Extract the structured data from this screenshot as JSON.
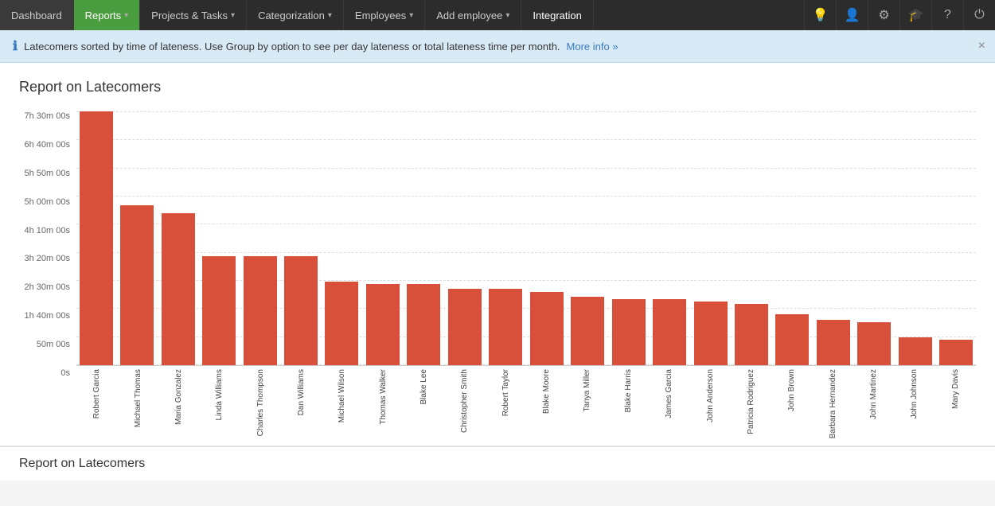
{
  "navbar": {
    "dashboard_label": "Dashboard",
    "reports_label": "Reports",
    "projects_label": "Projects & Tasks",
    "categorization_label": "Categorization",
    "employees_label": "Employees",
    "add_employee_label": "Add employee",
    "integration_label": "Integration"
  },
  "banner": {
    "text": "Latecomers sorted by time of lateness. Use Group by option to see per day lateness or total lateness time per month.",
    "link_text": "More info »"
  },
  "chart": {
    "title": "Report on Latecomers",
    "bottom_title": "Report on Latecomers",
    "y_labels": [
      "7h 30m 00s",
      "6h 40m 00s",
      "5h 50m 00s",
      "5h 00m 00s",
      "4h 10m 00s",
      "3h 20m 00s",
      "2h 30m 00s",
      "1h 40m 00s",
      "50m 00s",
      "0s"
    ],
    "bars": [
      {
        "name": "Robert Garcia",
        "height_pct": 100
      },
      {
        "name": "Michael Thomas",
        "height_pct": 63
      },
      {
        "name": "Maria Gonzalez",
        "height_pct": 60
      },
      {
        "name": "Linda Williams",
        "height_pct": 43
      },
      {
        "name": "Charles Thompson",
        "height_pct": 43
      },
      {
        "name": "Dan Williams",
        "height_pct": 43
      },
      {
        "name": "Michael Wilson",
        "height_pct": 33
      },
      {
        "name": "Thomas Walker",
        "height_pct": 32
      },
      {
        "name": "Blake Lee",
        "height_pct": 32
      },
      {
        "name": "Christopher Smith",
        "height_pct": 30
      },
      {
        "name": "Robert Taylor",
        "height_pct": 30
      },
      {
        "name": "Blake Moore",
        "height_pct": 29
      },
      {
        "name": "Tanya Miller",
        "height_pct": 27
      },
      {
        "name": "Blake Harris",
        "height_pct": 26
      },
      {
        "name": "James Garcia",
        "height_pct": 26
      },
      {
        "name": "John Anderson",
        "height_pct": 25
      },
      {
        "name": "Patricia Rodriguez",
        "height_pct": 24
      },
      {
        "name": "John Brown",
        "height_pct": 20
      },
      {
        "name": "Barbara Hernandez",
        "height_pct": 18
      },
      {
        "name": "John Martinez",
        "height_pct": 17
      },
      {
        "name": "John Johnson",
        "height_pct": 11
      },
      {
        "name": "Mary Davis",
        "height_pct": 10
      }
    ]
  }
}
